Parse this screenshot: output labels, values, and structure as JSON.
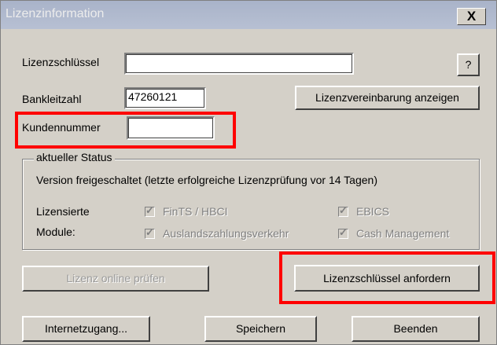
{
  "window": {
    "title": "Lizenzinformation",
    "close_label": "X"
  },
  "license_key": {
    "label": "Lizenzschlüssel",
    "value": "",
    "help_label": "?"
  },
  "bank_code": {
    "label": "Bankleitzahl",
    "value": "47260121"
  },
  "show_agreement_label": "Lizenzvereinbarung anzeigen",
  "customer_number": {
    "label": "Kundennummer",
    "value": ""
  },
  "status": {
    "group_label": "aktueller Status",
    "text": "Version freigeschaltet (letzte erfolgreiche Lizenzprüfung vor 14 Tagen)",
    "modules_label_1": "Lizensierte",
    "modules_label_2": "Module:",
    "modules": [
      {
        "label": "FinTS / HBCI",
        "checked": true,
        "enabled": false
      },
      {
        "label": "EBICS",
        "checked": true,
        "enabled": false
      },
      {
        "label": "Auslandszahlungsverkehr",
        "checked": true,
        "enabled": false
      },
      {
        "label": "Cash Management",
        "checked": true,
        "enabled": false
      }
    ]
  },
  "buttons": {
    "check_online": "Lizenz online prüfen",
    "request_key": "Lizenzschlüssel anfordern",
    "internet_access": "Internetzugang...",
    "save": "Speichern",
    "exit": "Beenden"
  },
  "highlight_color": "#ff0000"
}
